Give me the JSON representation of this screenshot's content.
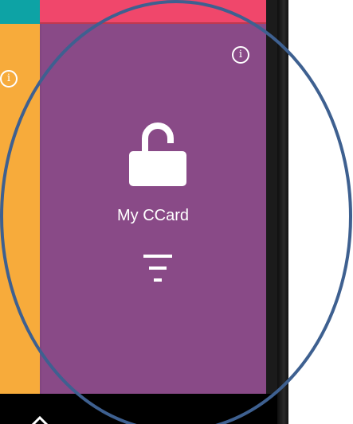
{
  "tile": {
    "label": "My CCard"
  },
  "icons": {
    "info_glyph": "i",
    "lock": "unlocked-padlock",
    "filter": "filter-lines",
    "home": "home"
  },
  "colors": {
    "teal": "#0da3a5",
    "pink": "#f0476b",
    "orange": "#f7ab3b",
    "purple": "#894a87",
    "annotation_circle": "#3e6090"
  }
}
